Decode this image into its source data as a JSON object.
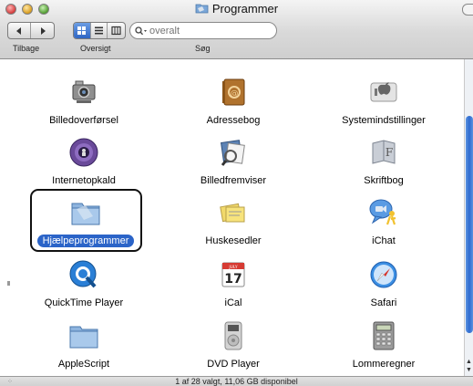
{
  "window": {
    "title": "Programmer"
  },
  "toolbar": {
    "back_label": "Tilbage",
    "view_label": "Oversigt",
    "search_label": "Søg",
    "search_placeholder": "overalt"
  },
  "items": [
    {
      "label": "Billedoverførsel",
      "icon": "image-capture-icon"
    },
    {
      "label": "Adressebog",
      "icon": "address-book-icon"
    },
    {
      "label": "Systemindstillinger",
      "icon": "system-preferences-icon"
    },
    {
      "label": "Internetopkald",
      "icon": "internet-connect-icon"
    },
    {
      "label": "Billedfremviser",
      "icon": "preview-icon"
    },
    {
      "label": "Skriftbog",
      "icon": "font-book-icon"
    },
    {
      "label": "Hjælpeprogrammer",
      "icon": "utilities-folder-icon",
      "selected": true
    },
    {
      "label": "Huskesedler",
      "icon": "stickies-icon"
    },
    {
      "label": "iChat",
      "icon": "ichat-icon"
    },
    {
      "label": "QuickTime Player",
      "icon": "quicktime-icon"
    },
    {
      "label": "iCal",
      "icon": "ical-icon",
      "day": "17",
      "month": "JULY"
    },
    {
      "label": "Safari",
      "icon": "safari-icon"
    },
    {
      "label": "AppleScript",
      "icon": "applescript-folder-icon"
    },
    {
      "label": "DVD Player",
      "icon": "dvd-player-icon"
    },
    {
      "label": "Lommeregner",
      "icon": "calculator-icon"
    }
  ],
  "status": {
    "text": "1 af 28 valgt, 11,06 GB disponibel"
  },
  "colors": {
    "selection": "#2b64c8",
    "scroll_thumb": "#2e6bd0"
  }
}
